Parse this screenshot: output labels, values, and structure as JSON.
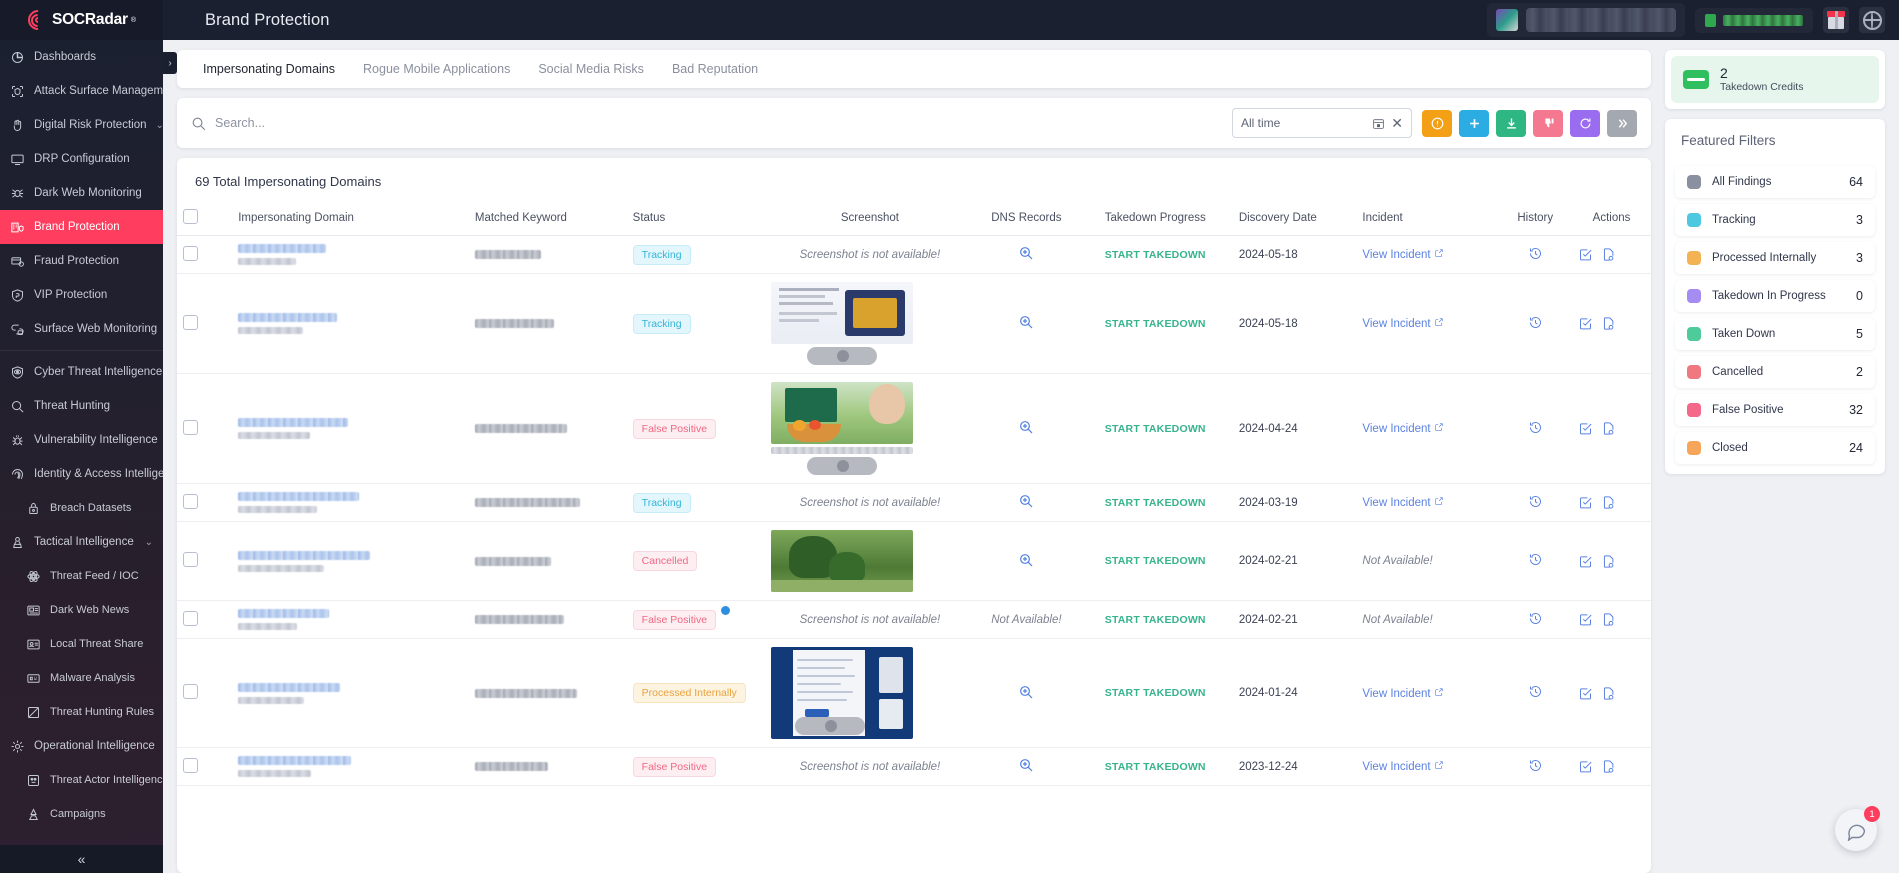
{
  "brand": {
    "name": "SOCRadar",
    "reg": "®",
    "logo_icon": "radar-logo-icon"
  },
  "header": {
    "page_title": "Brand Protection",
    "org_avatar": "org-avatar",
    "gift_icon": "gift-icon",
    "globe_icon": "globe-icon"
  },
  "sidebar": {
    "collapse_icon": "collapse-left-icon",
    "expander_icon": "chevron-right-icon",
    "items": [
      {
        "label": "Dashboards",
        "icon": "dashboard-icon",
        "level": 0,
        "active": false,
        "chevron": ""
      },
      {
        "label": "Attack Surface Management",
        "icon": "attack-surface-icon",
        "level": 0,
        "active": false,
        "chevron": "›"
      },
      {
        "label": "Digital Risk Protection",
        "icon": "hand-shield-icon",
        "level": 0,
        "active": false,
        "chevron": "⌄"
      },
      {
        "label": "DRP Configuration",
        "icon": "monitor-config-icon",
        "level": 0,
        "active": false,
        "chevron": ""
      },
      {
        "label": "Dark Web Monitoring",
        "icon": "spider-icon",
        "level": 0,
        "active": false,
        "chevron": ""
      },
      {
        "label": "Brand Protection",
        "icon": "building-shield-icon",
        "level": 0,
        "active": true,
        "chevron": ""
      },
      {
        "label": "Fraud Protection",
        "icon": "fraud-card-icon",
        "level": 0,
        "active": false,
        "chevron": ""
      },
      {
        "label": "VIP Protection",
        "icon": "vip-shield-icon",
        "level": 0,
        "active": false,
        "chevron": ""
      },
      {
        "label": "Surface Web Monitoring",
        "icon": "web-lock-icon",
        "level": 0,
        "active": false,
        "chevron": ""
      },
      {
        "label": "Cyber Threat Intelligence",
        "icon": "eye-shield-icon",
        "level": 0,
        "active": false,
        "chevron": "⌄",
        "help_badge": "?"
      },
      {
        "label": "Threat Hunting",
        "icon": "magnifier-icon",
        "level": 0,
        "active": false,
        "chevron": ""
      },
      {
        "label": "Vulnerability Intelligence",
        "icon": "bug-icon",
        "level": 0,
        "active": false,
        "chevron": ""
      },
      {
        "label": "Identity & Access Intelligence",
        "icon": "fingerprint-icon",
        "level": 0,
        "active": false,
        "chevron": "⌄"
      },
      {
        "label": "Breach Datasets",
        "icon": "lock-db-icon",
        "level": 1,
        "active": false,
        "chevron": ""
      },
      {
        "label": "Tactical Intelligence",
        "icon": "chess-pawn-icon",
        "level": 0,
        "active": false,
        "chevron": "⌄"
      },
      {
        "label": "Threat Feed / IOC",
        "icon": "atom-icon",
        "level": 1,
        "active": false,
        "chevron": ""
      },
      {
        "label": "Dark Web News",
        "icon": "news-icon",
        "level": 1,
        "active": false,
        "chevron": ""
      },
      {
        "label": "Local Threat Share",
        "icon": "share-card-icon",
        "level": 1,
        "active": false,
        "chevron": ""
      },
      {
        "label": "Malware Analysis",
        "icon": "malware-icon",
        "level": 1,
        "active": false,
        "chevron": ""
      },
      {
        "label": "Threat Hunting Rules",
        "icon": "rules-icon",
        "level": 1,
        "active": false,
        "chevron": ""
      },
      {
        "label": "Operational Intelligence",
        "icon": "gear-star-icon",
        "level": 0,
        "active": false,
        "chevron": "⌄"
      },
      {
        "label": "Threat Actor Intelligence",
        "icon": "actor-icon",
        "level": 1,
        "active": false,
        "chevron": ""
      },
      {
        "label": "Campaigns",
        "icon": "campaign-icon",
        "level": 1,
        "active": false,
        "chevron": ""
      }
    ]
  },
  "tabs": [
    {
      "label": "Impersonating Domains",
      "active": true
    },
    {
      "label": "Rogue Mobile Applications",
      "active": false
    },
    {
      "label": "Social Media Risks",
      "active": false
    },
    {
      "label": "Bad Reputation",
      "active": false
    }
  ],
  "toolbar": {
    "search_placeholder": "Search...",
    "search_value": "",
    "search_icon": "search-icon",
    "date_range_value": "All time",
    "calendar_icon": "calendar-icon",
    "clear_icon": "close-icon",
    "buttons": [
      {
        "name": "info-button",
        "icon": "alert-circle-icon",
        "color": "#f3a017"
      },
      {
        "name": "add-button",
        "icon": "plus-icon",
        "color": "#2bade3"
      },
      {
        "name": "download-button",
        "icon": "download-icon",
        "color": "#2fb783"
      },
      {
        "name": "false-positive-button",
        "icon": "thumbs-down-icon",
        "color": "#f4788f"
      },
      {
        "name": "refresh-button",
        "icon": "refresh-icon",
        "color": "#9a6cf0"
      },
      {
        "name": "more-button",
        "icon": "chevrons-right-icon",
        "color": "#a4a8b1"
      }
    ]
  },
  "table": {
    "title": "69 Total Impersonating Domains",
    "columns": [
      "Impersonating Domain",
      "Matched Keyword",
      "Status",
      "Screenshot",
      "DNS Records",
      "Takedown Progress",
      "Discovery Date",
      "Incident",
      "History",
      "Actions"
    ],
    "takedown_label": "START TAKEDOWN",
    "incident_label": "View Incident",
    "no_screenshot_text": "Screenshot is not available!",
    "not_available_text": "Not Available!",
    "zoom_icon": "zoom-in-icon",
    "history_icon": "history-clock-icon",
    "edit_icon": "checkbox-edit-icon",
    "report_icon": "document-search-icon",
    "external_icon": "external-link-icon",
    "rows": [
      {
        "status": "Tracking",
        "status_type": "tracking",
        "screenshot": "none",
        "dns": "icon",
        "takedown": "START TAKEDOWN",
        "date": "2024-05-18",
        "incident": "View Incident",
        "info_dot": false
      },
      {
        "status": "Tracking",
        "status_type": "tracking",
        "screenshot": "thumb-text",
        "dns": "icon",
        "takedown": "START TAKEDOWN",
        "date": "2024-05-18",
        "incident": "View Incident",
        "info_dot": false
      },
      {
        "status": "False Positive",
        "status_type": "false",
        "screenshot": "thumb-garden-kid",
        "dns": "icon",
        "takedown": "START TAKEDOWN",
        "date": "2024-04-24",
        "incident": "View Incident",
        "info_dot": false
      },
      {
        "status": "Tracking",
        "status_type": "tracking",
        "screenshot": "none",
        "dns": "icon",
        "takedown": "START TAKEDOWN",
        "date": "2024-03-19",
        "incident": "View Incident",
        "info_dot": false
      },
      {
        "status": "Cancelled",
        "status_type": "cancelled",
        "screenshot": "thumb-topiary",
        "dns": "icon",
        "takedown": "START TAKEDOWN",
        "date": "2024-02-21",
        "incident": "Not Available!",
        "info_dot": false
      },
      {
        "status": "False Positive",
        "status_type": "false",
        "screenshot": "none",
        "dns": "Not Available!",
        "takedown": "START TAKEDOWN",
        "date": "2024-02-21",
        "incident": "Not Available!",
        "info_dot": true
      },
      {
        "status": "Processed Internally",
        "status_type": "processed",
        "screenshot": "thumb-webpage",
        "dns": "icon",
        "takedown": "START TAKEDOWN",
        "date": "2024-01-24",
        "incident": "View Incident",
        "info_dot": false
      },
      {
        "status": "False Positive",
        "status_type": "false",
        "screenshot": "none",
        "dns": "icon",
        "takedown": "START TAKEDOWN",
        "date": "2023-12-24",
        "incident": "View Incident",
        "info_dot": false
      }
    ]
  },
  "credits": {
    "count": "2",
    "label": "Takedown Credits",
    "icon": "credit-card-icon"
  },
  "featured_filters": {
    "title": "Featured Filters",
    "items": [
      {
        "label": "All Findings",
        "count": "64",
        "color": "#8b90a0"
      },
      {
        "label": "Tracking",
        "count": "3",
        "color": "#4cc9e0"
      },
      {
        "label": "Processed Internally",
        "count": "3",
        "color": "#f4b košík"
      },
      {
        "label": "Takedown In Progress",
        "count": "0",
        "color": "#a48cf0"
      },
      {
        "label": "Taken Down",
        "count": "5",
        "color": "#4dcb9b"
      },
      {
        "label": "Cancelled",
        "count": "2",
        "color": "#f0797f"
      },
      {
        "label": "False Positive",
        "count": "32",
        "color": "#f4688a"
      },
      {
        "label": "Closed",
        "count": "24",
        "color": "#f5a košík"
      }
    ]
  },
  "chat": {
    "badge": "1",
    "icon": "chat-bubble-icon"
  }
}
